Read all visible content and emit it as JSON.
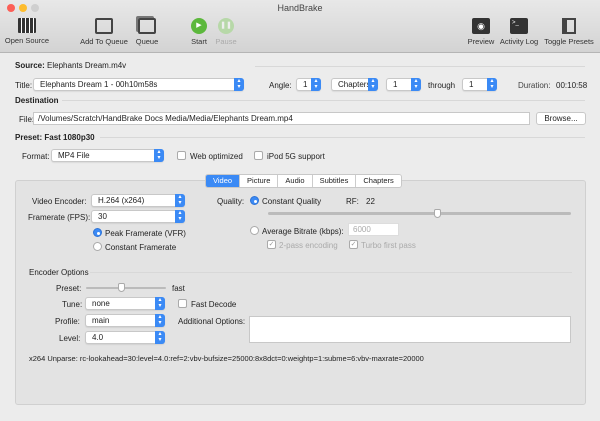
{
  "window": {
    "title": "HandBrake"
  },
  "toolbar": {
    "open_source": "Open Source",
    "add_to_queue": "Add To Queue",
    "queue": "Queue",
    "start": "Start",
    "pause": "Pause",
    "preview": "Preview",
    "activity_log": "Activity Log",
    "toggle_presets": "Toggle Presets"
  },
  "source": {
    "label": "Source:",
    "value": "Elephants Dream.m4v"
  },
  "title_row": {
    "label": "Title:",
    "value": "Elephants Dream 1 - 00h10m58s",
    "angle_label": "Angle:",
    "angle": "1",
    "range_type": "Chapters",
    "from": "1",
    "through_label": "through",
    "to": "1",
    "duration_label": "Duration:",
    "duration": "00:10:58"
  },
  "destination": {
    "heading": "Destination",
    "file_label": "File:",
    "file": "/Volumes/Scratch/HandBrake Docs Media/Media/Elephants Dream.mp4",
    "browse": "Browse..."
  },
  "preset": {
    "label": "Preset:",
    "value": "Fast 1080p30"
  },
  "format": {
    "label": "Format:",
    "value": "MP4 File",
    "web_optimized": "Web optimized",
    "ipod": "iPod 5G support"
  },
  "tabs": [
    "Video",
    "Picture",
    "Audio",
    "Subtitles",
    "Chapters"
  ],
  "video": {
    "encoder_label": "Video Encoder:",
    "encoder": "H.264 (x264)",
    "framerate_label": "Framerate (FPS):",
    "framerate": "30",
    "peak": "Peak Framerate (VFR)",
    "constant": "Constant Framerate",
    "quality_label": "Quality:",
    "constant_quality": "Constant Quality",
    "rf_label": "RF:",
    "rf": "22",
    "rf_fraction": 0.56,
    "avg_bitrate": "Average Bitrate (kbps):",
    "bitrate_placeholder": "6000",
    "two_pass": "2-pass encoding",
    "turbo": "Turbo first pass"
  },
  "encoder_options": {
    "heading": "Encoder Options",
    "preset_label": "Preset:",
    "preset_value": "fast",
    "preset_fraction": 0.44,
    "tune_label": "Tune:",
    "tune": "none",
    "fast_decode": "Fast Decode",
    "profile_label": "Profile:",
    "profile": "main",
    "additional_label": "Additional Options:",
    "additional": "",
    "level_label": "Level:",
    "level": "4.0",
    "unparse": "x264 Unparse: rc-lookahead=30:level=4.0:ref=2:vbv-bufsize=25000:8x8dct=0:weightp=1:subme=6:vbv-maxrate=20000"
  }
}
